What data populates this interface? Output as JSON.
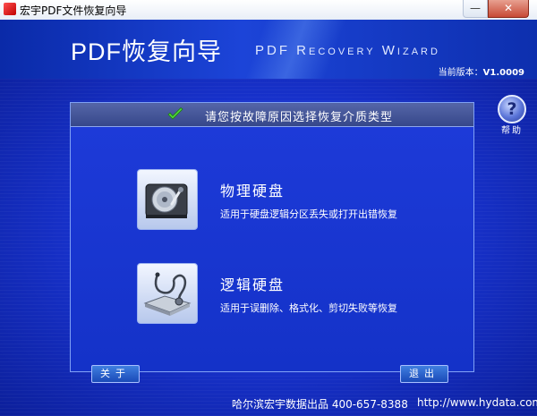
{
  "window": {
    "title": "宏宇PDF文件恢复向导",
    "minimize_glyph": "—",
    "close_glyph": "✕"
  },
  "header": {
    "app_title": "PDF恢复向导",
    "app_subtitle": "PDF Recovery Wizard",
    "version_label": "当前版本：",
    "version_value": "V1.0009"
  },
  "help": {
    "glyph": "?",
    "label": "帮助"
  },
  "panel": {
    "title": "请您按故障原因选择恢复介质类型",
    "options": [
      {
        "title": "物理硬盘",
        "description": "适用于硬盘逻辑分区丢失或打开出错恢复",
        "icon": "hard-disk-icon"
      },
      {
        "title": "逻辑硬盘",
        "description": "适用于误删除、格式化、剪切失败等恢复",
        "icon": "disk-stethoscope-icon"
      }
    ]
  },
  "footer": {
    "about_label": "关于",
    "exit_label": "退出",
    "company": "哈尔滨宏宇数据出品  400-657-8388",
    "url": "http://www.hydata.com"
  },
  "colors": {
    "background": "#1530c8",
    "panel_header": "#3f5098",
    "check": "#48c93a"
  }
}
